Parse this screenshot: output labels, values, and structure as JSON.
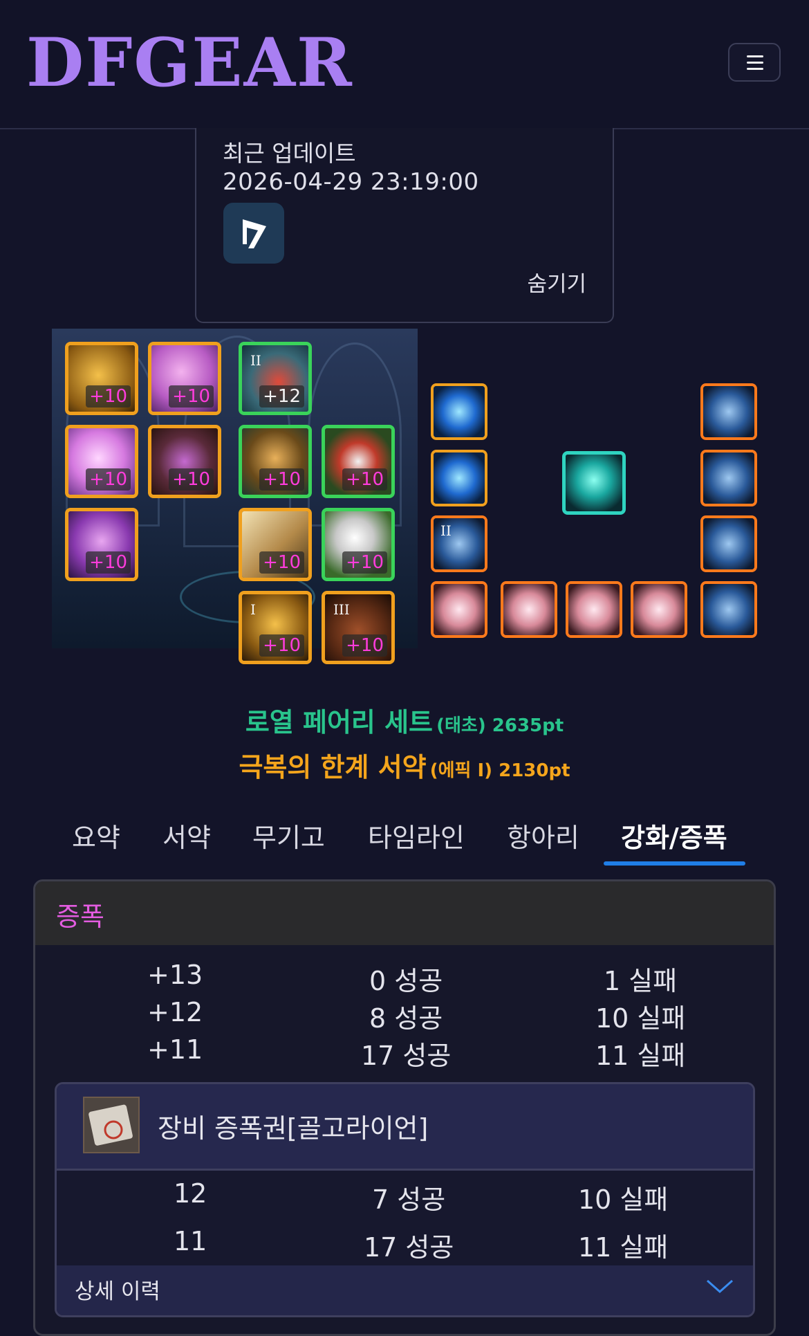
{
  "header": {
    "logo": "DFGEAR",
    "menu_icon": "hamburger-icon"
  },
  "info": {
    "label": "최근 업데이트",
    "timestamp": "2026-04-29 23:19:00",
    "hide_link": "숨기기"
  },
  "equipment": {
    "left_slots": [
      {
        "enhance": "+10",
        "style": "magenta",
        "rank": ""
      },
      {
        "enhance": "+10",
        "style": "magenta",
        "rank": ""
      },
      {
        "enhance": "+12",
        "style": "white",
        "rank": "II"
      },
      {
        "enhance": "+10",
        "style": "magenta",
        "rank": ""
      },
      {
        "enhance": "+10",
        "style": "magenta",
        "rank": ""
      },
      {
        "enhance": "+10",
        "style": "magenta",
        "rank": ""
      },
      {
        "enhance": "+10",
        "style": "magenta",
        "rank": ""
      },
      {
        "enhance": "+10",
        "style": "magenta",
        "rank": ""
      },
      {
        "enhance": "+10",
        "style": "magenta",
        "rank": ""
      },
      {
        "enhance": "+10",
        "style": "magenta",
        "rank": ""
      },
      {
        "enhance": "+10",
        "style": "magenta",
        "rank": "I"
      },
      {
        "enhance": "+10",
        "style": "magenta",
        "rank": "III"
      }
    ],
    "right_rank": "II"
  },
  "sets": [
    {
      "name": "로열 페어리 세트",
      "sub": "(태초) 2635pt",
      "color": "#29c48c"
    },
    {
      "name": "극복의 한계 서약",
      "sub": "(에픽 Ⅰ) 2130pt",
      "color": "#f4a51c"
    }
  ],
  "tabs": [
    "요약",
    "서약",
    "무기고",
    "타임라인",
    "항아리",
    "강화/증폭"
  ],
  "active_tab": "강화/증폭",
  "amplify": {
    "title": "증폭",
    "rows": [
      {
        "level": "+13",
        "success": "0 성공",
        "fail": "1 실패"
      },
      {
        "level": "+12",
        "success": "8 성공",
        "fail": "10 실패"
      },
      {
        "level": "+11",
        "success": "17 성공",
        "fail": "11 실패"
      }
    ],
    "ticket": {
      "name": "장비 증폭권[골고라이언]",
      "rows": [
        {
          "level": "12",
          "success": "7 성공",
          "fail": "10 실패"
        },
        {
          "level": "11",
          "success": "17 성공",
          "fail": "11 실패"
        }
      ],
      "detail_label": "상세 이력"
    }
  }
}
